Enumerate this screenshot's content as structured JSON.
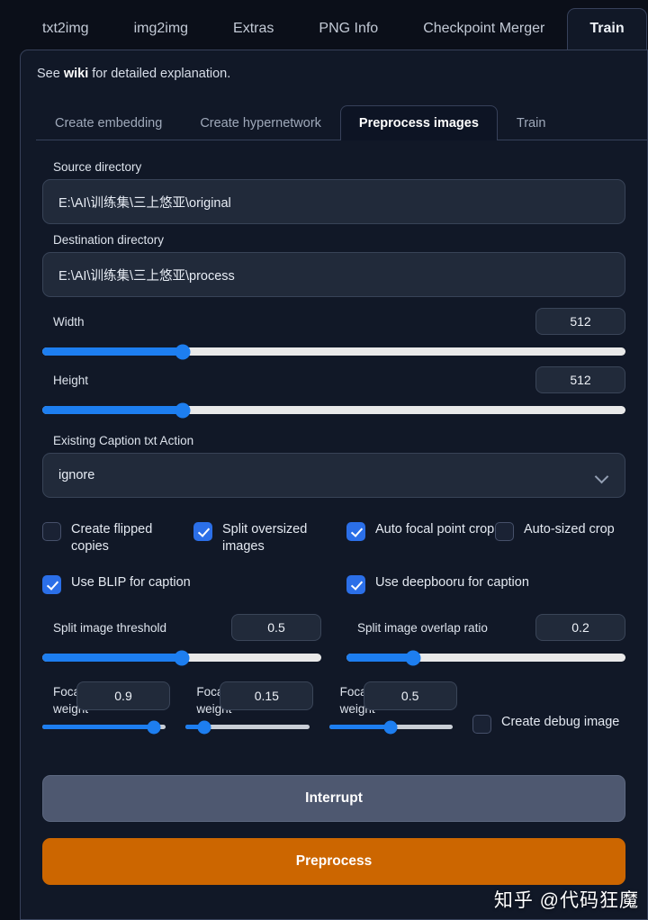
{
  "top_tabs": [
    {
      "label": "txt2img",
      "active": false
    },
    {
      "label": "img2img",
      "active": false
    },
    {
      "label": "Extras",
      "active": false
    },
    {
      "label": "PNG Info",
      "active": false
    },
    {
      "label": "Checkpoint Merger",
      "active": false
    },
    {
      "label": "Train",
      "active": true
    }
  ],
  "notice": {
    "prefix": "See ",
    "link": "wiki",
    "suffix": " for detailed explanation."
  },
  "sub_tabs": [
    {
      "label": "Create embedding",
      "active": false
    },
    {
      "label": "Create hypernetwork",
      "active": false
    },
    {
      "label": "Preprocess images",
      "active": true
    },
    {
      "label": "Train",
      "active": false
    }
  ],
  "form": {
    "source_directory": {
      "label": "Source directory",
      "value": "E:\\AI\\训练集\\三上悠亚\\original"
    },
    "destination_directory": {
      "label": "Destination directory",
      "value": "E:\\AI\\训练集\\三上悠亚\\process"
    },
    "width": {
      "label": "Width",
      "value": "512",
      "percent": 24
    },
    "height": {
      "label": "Height",
      "value": "512",
      "percent": 24
    },
    "caption_action": {
      "label": "Existing Caption txt Action",
      "value": "ignore"
    },
    "checkboxes_row1": [
      {
        "label": "Create flipped copies",
        "checked": false
      },
      {
        "label": "Split oversized images",
        "checked": true
      },
      {
        "label": "Auto focal point crop",
        "checked": true
      },
      {
        "label": "Auto-sized crop",
        "checked": false
      }
    ],
    "checkboxes_row2": [
      {
        "label": "Use BLIP for caption",
        "checked": true
      },
      {
        "label": "Use deepbooru for caption",
        "checked": true
      }
    ],
    "split_threshold": {
      "label": "Split image threshold",
      "value": "0.5",
      "percent": 50
    },
    "split_overlap": {
      "label": "Split image overlap ratio",
      "value": "0.2",
      "percent": 20
    },
    "focal_face_weight": {
      "label": "Focal point face weight",
      "value": "0.9",
      "percent": 90
    },
    "focal_entropy_weight": {
      "label": "Focal point entropy weight",
      "value": "0.15",
      "percent": 15
    },
    "focal_edges_weight": {
      "label": "Focal point edges weight",
      "value": "0.5",
      "percent": 50
    },
    "create_debug_image": {
      "label": "Create debug image",
      "checked": false
    }
  },
  "buttons": {
    "interrupt": "Interrupt",
    "preprocess": "Preprocess"
  },
  "watermark": "知乎 @代码狂魔",
  "colors": {
    "accent_orange": "#cc6600",
    "accent_blue": "#1d7ef0",
    "checkbox_blue": "#2b6fe8",
    "panel_bg": "#111827",
    "app_bg": "#0b0f19"
  }
}
